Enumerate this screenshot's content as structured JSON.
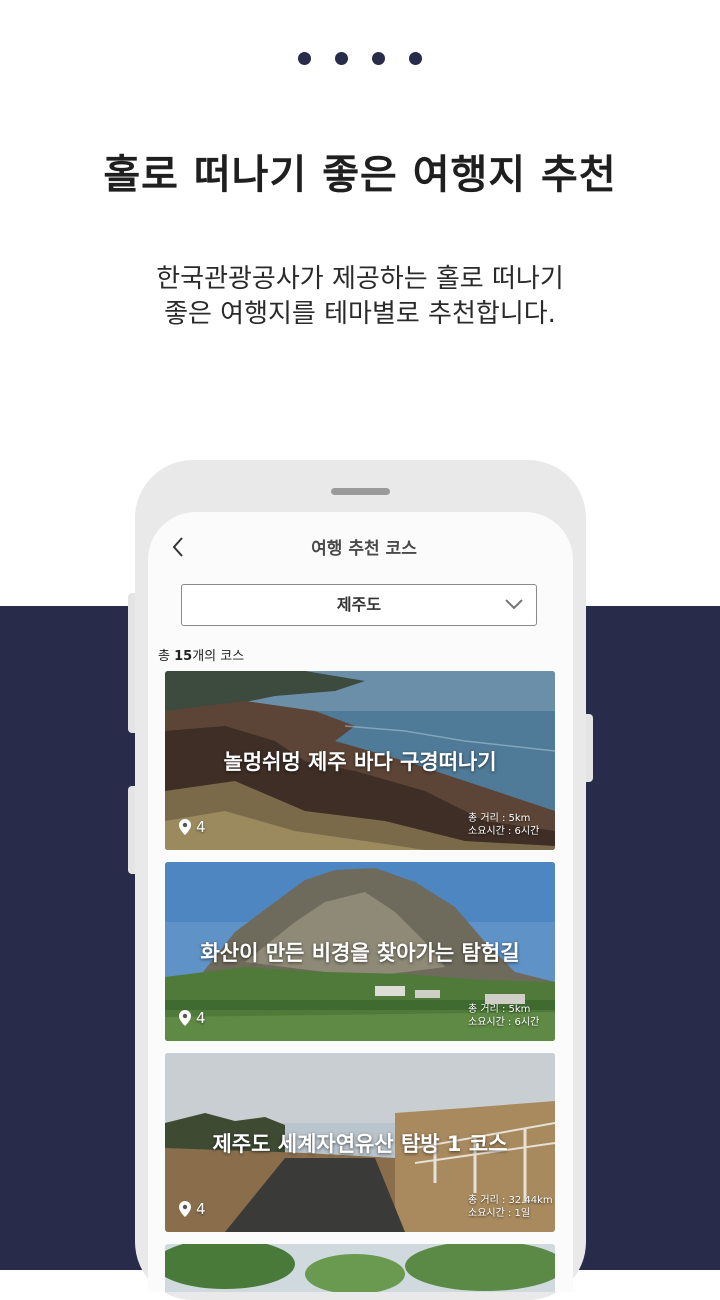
{
  "headline": "홀로 떠나기 좋은 여행지 추천",
  "subtext": {
    "line1": "한국관광공사가 제공하는 홀로 떠나기",
    "line2": "좋은 여행지를 테마별로 추천합니다."
  },
  "pager": {
    "count": 4
  },
  "app": {
    "back_icon": "chevron-left-icon",
    "title": "여행 추천 코스",
    "region": {
      "selected": "제주도",
      "icon": "chevron-down-icon"
    },
    "course_count": {
      "prefix": "총 ",
      "number": "15",
      "suffix": "개의 코스"
    },
    "courses": [
      {
        "title": "놀멍쉬멍 제주 바다 구경떠나기",
        "pins": "4",
        "distance": "총 거리 : 5km",
        "duration": "소요시간 : 6시간"
      },
      {
        "title": "화산이 만든 비경을 찾아가는 탐험길",
        "pins": "4",
        "distance": "총 거리 : 5km",
        "duration": "소요시간 : 6시간"
      },
      {
        "title": "제주도 세계자연유산 탐방 1 코스",
        "pins": "4",
        "distance": "총 거리 : 32.44km",
        "duration": "소요시간 : 1일"
      }
    ]
  },
  "colors": {
    "navy": "#282c4a",
    "white": "#ffffff"
  }
}
